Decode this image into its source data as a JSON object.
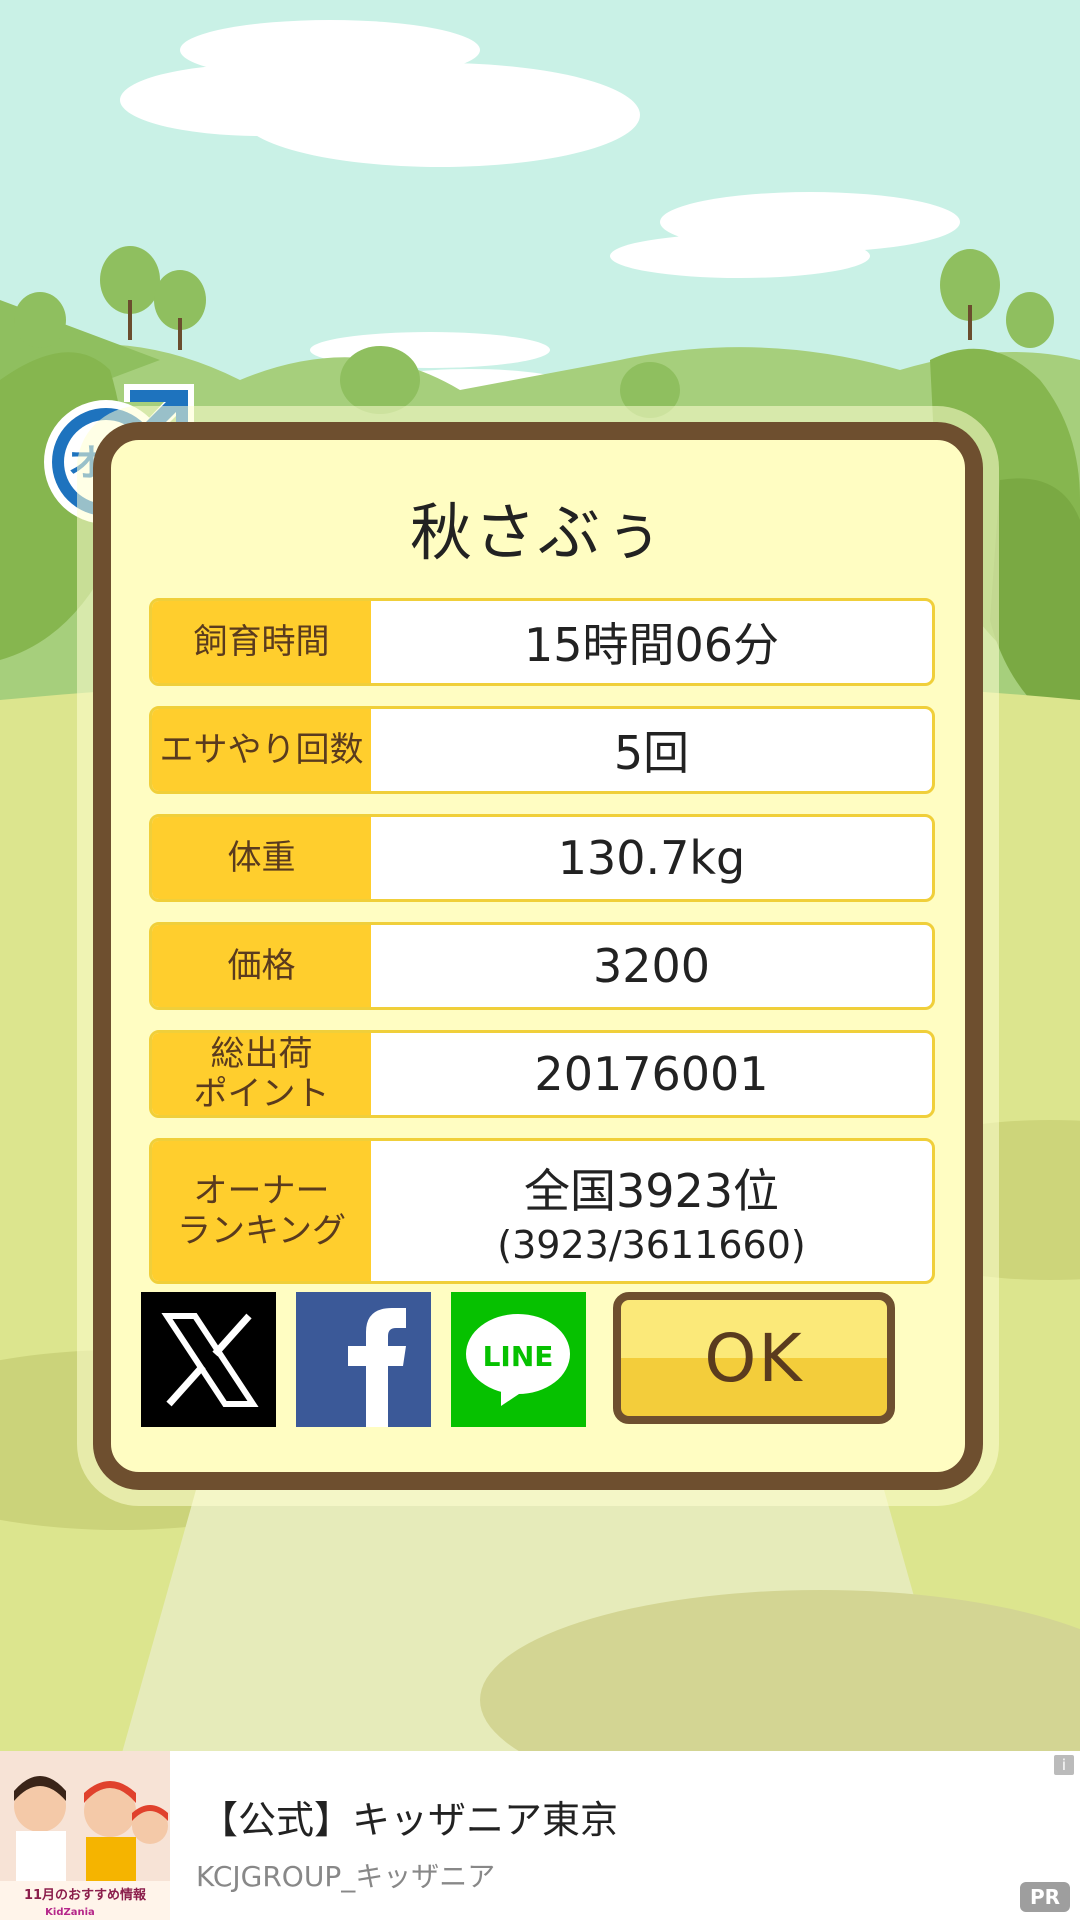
{
  "pig_name": "秋さぶぅ",
  "gender_badge": "オス",
  "stats": [
    {
      "label": "飼育時間",
      "value": "15時間06分"
    },
    {
      "label": "エサやり回数",
      "value": "5回"
    },
    {
      "label": "体重",
      "value": "130.7kg"
    },
    {
      "label": "価格",
      "value": "3200"
    },
    {
      "label": "総出荷\nポイント",
      "value": "20176001"
    },
    {
      "label": "オーナー\nランキング",
      "value": "全国3923位",
      "subvalue": "(3923/3611660)"
    }
  ],
  "buttons": {
    "x": "X",
    "facebook": "f",
    "line": "LINE",
    "ok": "OK"
  },
  "ad": {
    "title": "【公式】キッザニア東京",
    "advertiser": "KCJGROUP_キッザニア",
    "info": "i",
    "pr": "PR",
    "image_caption": "11月のおすすめ情報",
    "image_brand": "KidZania"
  },
  "colors": {
    "sky": "#c9f1e6",
    "dialog_border": "#6e4f2f",
    "dialog_bg": "#fffdc2",
    "label_bg": "#ffce2d",
    "gender_blue": "#1e73be"
  }
}
